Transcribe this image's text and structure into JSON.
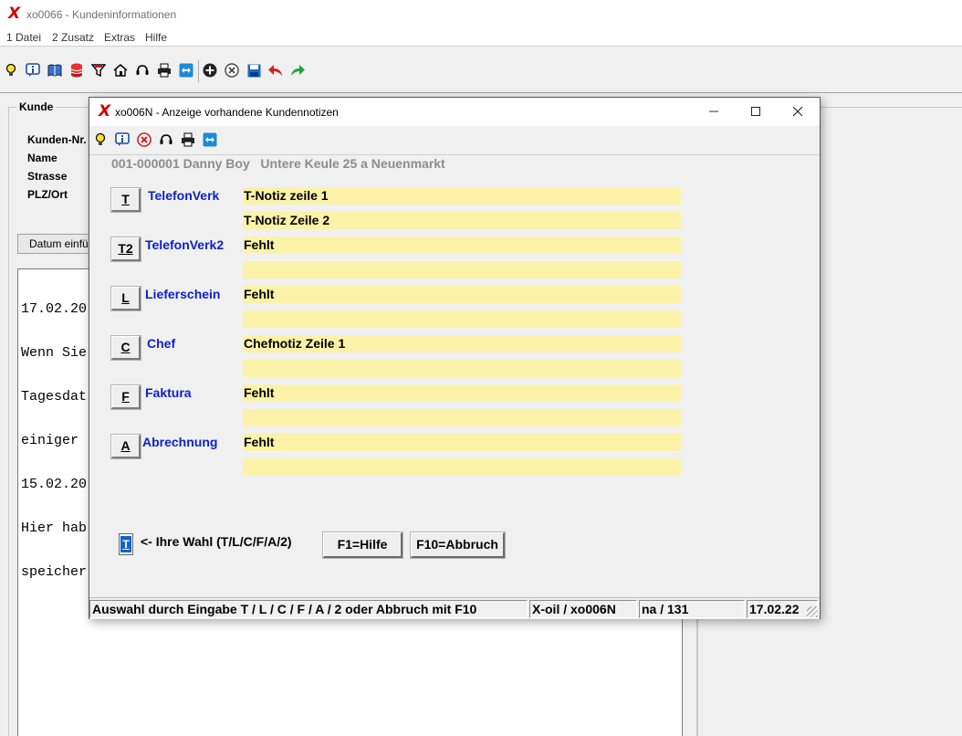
{
  "main": {
    "title": "xo0066 - Kundeninformationen",
    "logo": "X",
    "menu": [
      "1 Datei",
      "2 Zusatz",
      "Extras",
      "Hilfe"
    ],
    "toolbar_icons": [
      "bulb-icon",
      "info-icon",
      "book-icon",
      "database-icon",
      "filter-icon",
      "home-icon",
      "headset-icon",
      "printer-icon",
      "teamviewer-icon",
      "add-icon",
      "cancel-icon",
      "save-icon",
      "undo-icon",
      "redo-icon"
    ],
    "group_label": "Kunde",
    "fields": [
      "Kunden-Nr.",
      "Name",
      "Strasse",
      "PLZ/Ort"
    ],
    "datum_button": "Datum einfü",
    "memo_lines": [
      "17.02.20",
      "Wenn Sie",
      "Tagesdat",
      "einiger ",
      "15.02.20",
      "Hier hab",
      "speicher"
    ]
  },
  "dialog": {
    "title": "xo006N - Anzeige vorhandene Kundennotizen",
    "logo": "X",
    "window_buttons": [
      "minimize",
      "maximize",
      "close"
    ],
    "toolbar_icons": [
      "bulb-icon",
      "info-icon",
      "cancel-icon",
      "headset-icon",
      "printer-icon",
      "teamviewer-icon"
    ],
    "customer_info": "001-000001 Danny Boy   Untere Keule 25 a Neuenmarkt",
    "categories": [
      {
        "key": "T",
        "label": "TelefonVerk",
        "notes": [
          "T-Notiz zeile 1",
          "T-Notiz Zeile 2"
        ]
      },
      {
        "key": "T2",
        "label": "TelefonVerk2",
        "notes": [
          "Fehlt",
          ""
        ]
      },
      {
        "key": "L",
        "label": "Lieferschein",
        "notes": [
          "Fehlt",
          ""
        ]
      },
      {
        "key": "C",
        "label": "Chef",
        "notes": [
          "Chefnotiz Zeile 1",
          ""
        ]
      },
      {
        "key": "F",
        "label": "Faktura",
        "notes": [
          "Fehlt",
          ""
        ]
      },
      {
        "key": "A",
        "label": "Abrechnung",
        "notes": [
          "Fehlt",
          ""
        ]
      }
    ],
    "choice_value": "T",
    "choice_label": "<- Ihre Wahl (T/L/C/F/A/2)",
    "help_button": "F1=Hilfe",
    "cancel_button": "F10=Abbruch",
    "status": {
      "message": "Auswahl durch Eingabe T / L / C / F / A / 2 oder Abbruch mit F10",
      "program": "X-oil / xo006N",
      "record": "na / 131",
      "date": "17.02.22"
    }
  }
}
